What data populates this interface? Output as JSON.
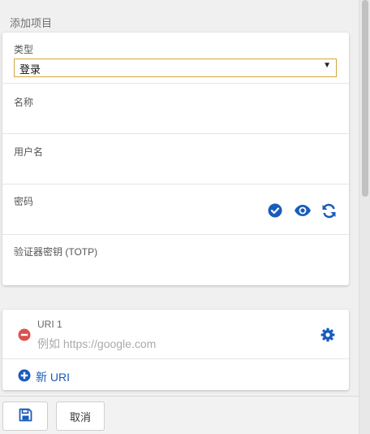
{
  "section_title": "添加项目",
  "form": {
    "type_label": "类型",
    "type_value": "登录",
    "name_label": "名称",
    "username_label": "用户名",
    "password_label": "密码",
    "totp_label": "验证器密钥 (TOTP)"
  },
  "uri": {
    "label": "URI 1",
    "placeholder": "例如 https://google.com",
    "new_uri_label": "新 URI"
  },
  "footer": {
    "cancel_label": "取消"
  },
  "colors": {
    "accent_blue": "#1a5bbb",
    "remove_red": "#d9534f",
    "select_border": "#d4a73c"
  },
  "icons": {
    "check": "check-circle-icon",
    "eye": "eye-icon",
    "refresh": "refresh-icon",
    "remove": "minus-circle-icon",
    "settings": "gear-icon",
    "add": "plus-circle-icon",
    "save": "floppy-disk-icon"
  }
}
